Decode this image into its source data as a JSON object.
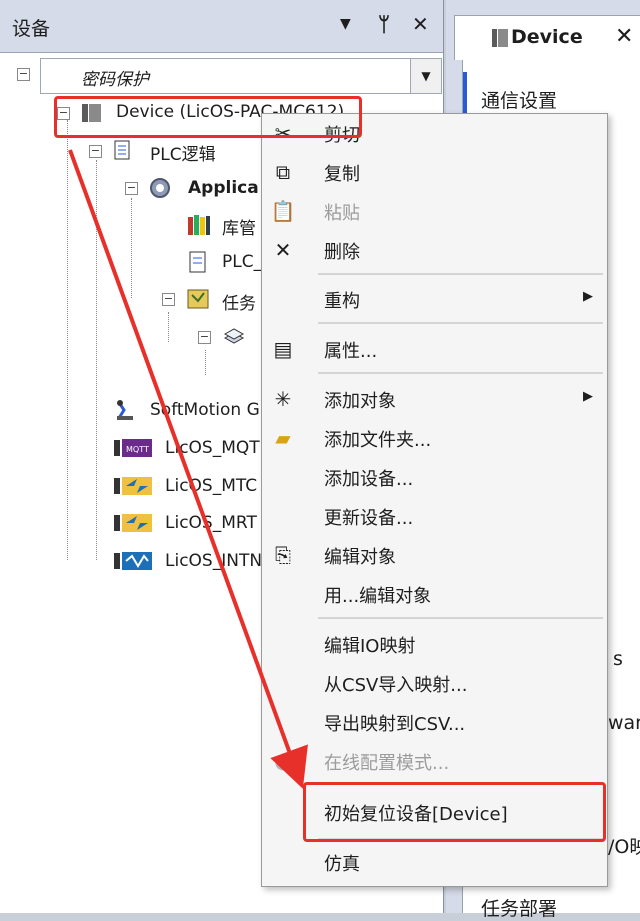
{
  "left_panel": {
    "title": "设备",
    "controls": {
      "dropdown": "▼",
      "pin": "ᛘ",
      "close": "✕"
    },
    "combo_value": "密码保护",
    "tree": [
      {
        "label": "Device (LicOS-PAC-MC612)"
      },
      {
        "label": "PLC逻辑"
      },
      {
        "label": "Applica"
      },
      {
        "label": "库管"
      },
      {
        "label": "PLC_"
      },
      {
        "label": "任务"
      },
      {
        "label": ""
      },
      {
        "label": "SoftMotion G"
      },
      {
        "label": "LicOS_MQT"
      },
      {
        "label": "LicOS_MTC"
      },
      {
        "label": "LicOS_MRT"
      },
      {
        "label": "LicOS_INTN"
      }
    ]
  },
  "right_panel": {
    "tab_label": "Device",
    "tab_close": "✕",
    "items": [
      "通信设置",
      "s",
      "ware",
      "/O映",
      "任务部署"
    ]
  },
  "context_menu": {
    "items": [
      {
        "label": "剪切",
        "icon": "cut-icon",
        "enabled": true
      },
      {
        "label": "复制",
        "icon": "copy-icon",
        "enabled": true
      },
      {
        "label": "粘贴",
        "icon": "paste-icon",
        "enabled": false
      },
      {
        "label": "删除",
        "icon": "delete-icon",
        "enabled": true
      },
      {
        "label": "重构",
        "icon": "",
        "enabled": true,
        "submenu": true
      },
      {
        "label": "属性...",
        "icon": "properties-icon",
        "enabled": true
      },
      {
        "label": "添加对象",
        "icon": "add-object-icon",
        "enabled": true,
        "submenu": true
      },
      {
        "label": "添加文件夹...",
        "icon": "folder-icon",
        "enabled": true
      },
      {
        "label": "添加设备...",
        "icon": "",
        "enabled": true
      },
      {
        "label": "更新设备...",
        "icon": "",
        "enabled": true
      },
      {
        "label": "编辑对象",
        "icon": "edit-object-icon",
        "enabled": true
      },
      {
        "label": "用...编辑对象",
        "icon": "",
        "enabled": true
      },
      {
        "label": "编辑IO映射",
        "icon": "",
        "enabled": true
      },
      {
        "label": "从CSV导入映射...",
        "icon": "",
        "enabled": true
      },
      {
        "label": "导出映射到CSV...",
        "icon": "",
        "enabled": true
      },
      {
        "label": "在线配置模式...",
        "icon": "online-config-icon",
        "enabled": false
      },
      {
        "label": "初始复位设备[Device]",
        "icon": "",
        "enabled": true
      },
      {
        "label": "仿真",
        "icon": "",
        "enabled": true
      }
    ],
    "submenu_arrow": "▶"
  },
  "annotation_color": "#e8302b"
}
